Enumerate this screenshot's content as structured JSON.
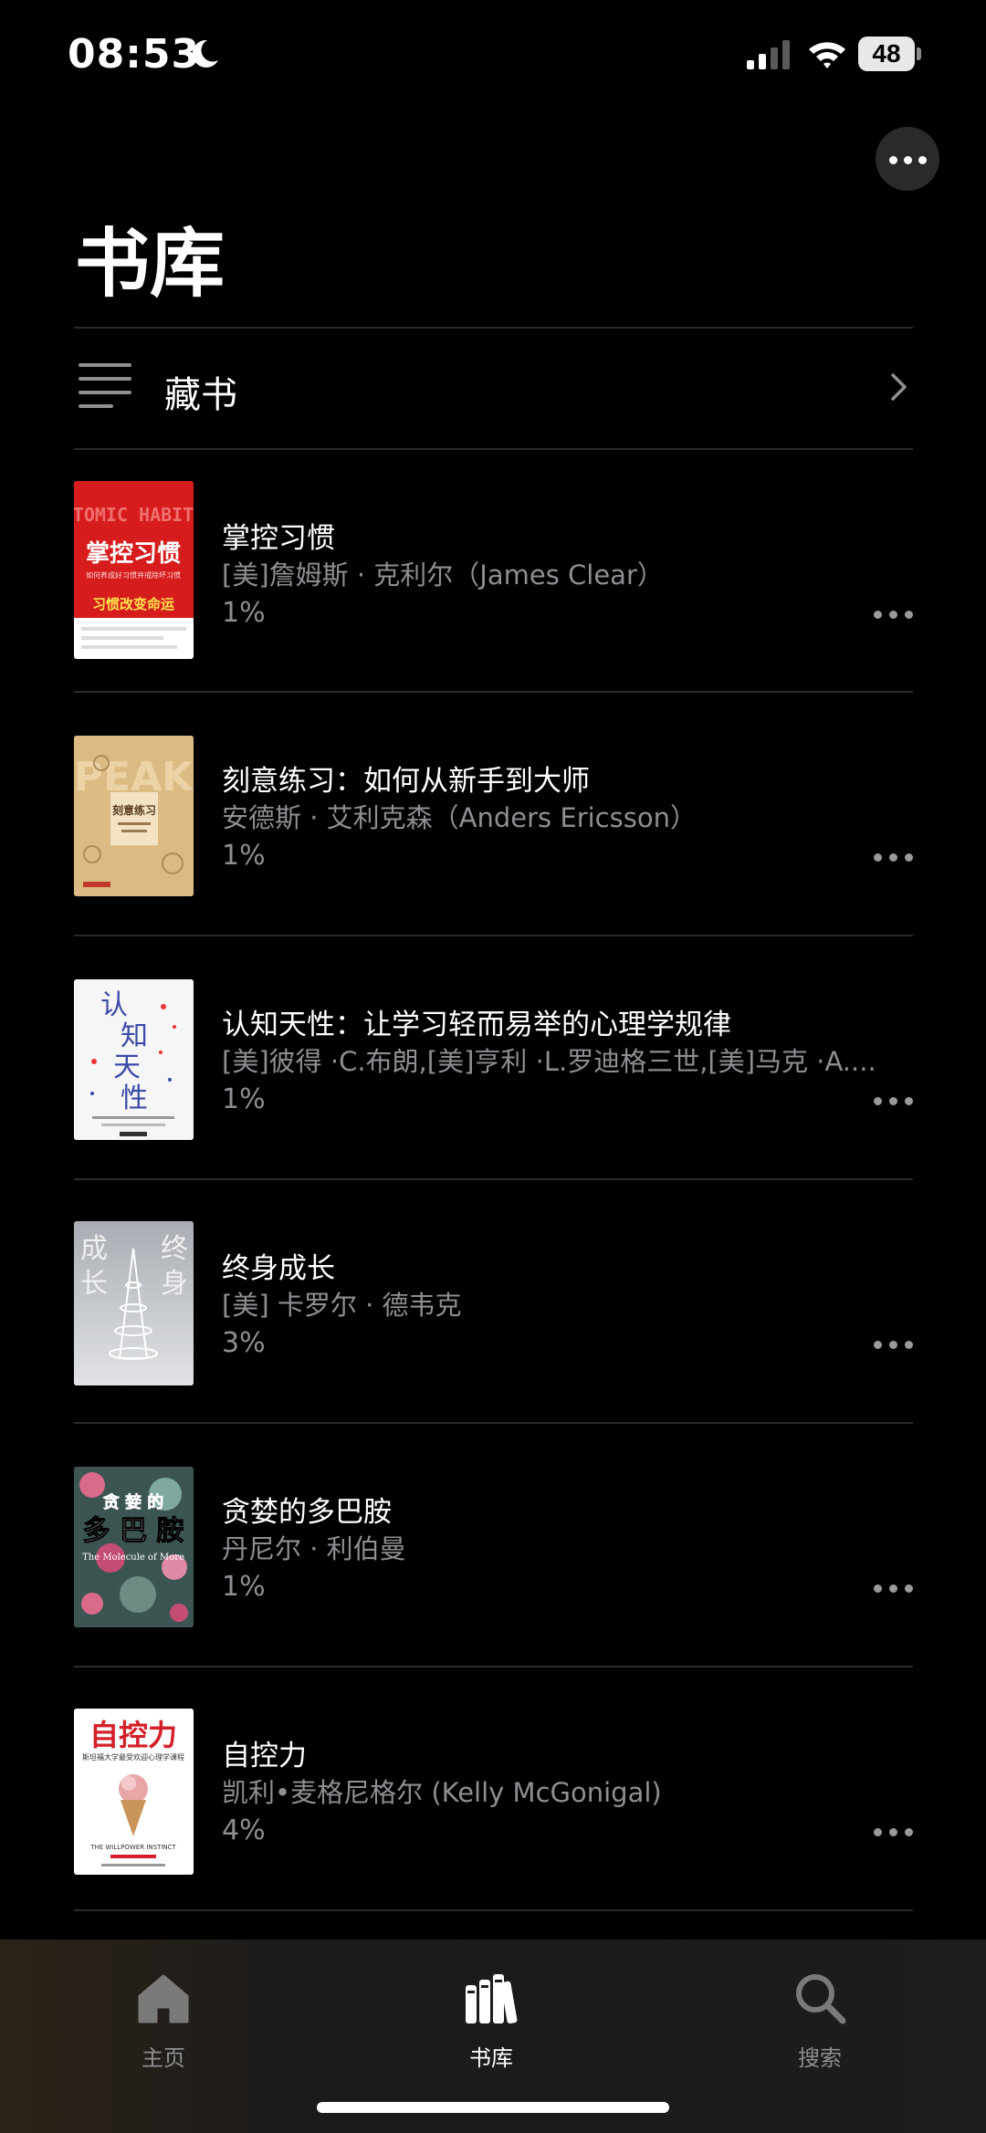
{
  "status_bar": {
    "time": "08:53",
    "battery": "48"
  },
  "header": {
    "title": "书库"
  },
  "collection": {
    "label": "藏书"
  },
  "books": [
    {
      "title": "掌控习惯",
      "author": "[美]詹姆斯 · 克利尔（James Clear）",
      "progress": "1%",
      "cover": {
        "title": "掌控习惯",
        "en": "ATOMIC HABITS",
        "subtitle": "如何养成好习惯并戒除坏习惯",
        "tagline": "习惯改变命运"
      }
    },
    {
      "title": "刻意练习：如何从新手到大师",
      "author": "安德斯 · 艾利克森（Anders Ericsson）",
      "progress": "1%",
      "cover": {
        "title": "刻意练习",
        "en": "PEAK"
      }
    },
    {
      "title": "认知天性：让学习轻而易举的心理学规律",
      "author": "[美]彼得 ·C.布朗,[美]亨利 ·L.罗迪格三世,[美]马克 ·A....",
      "progress": "1%",
      "cover": {
        "title1": "认",
        "title2": "知",
        "title3": "天",
        "title4": "性"
      }
    },
    {
      "title": "终身成长",
      "author": "[美] 卡罗尔 · 德韦克",
      "progress": "3%",
      "cover": {
        "left1": "成",
        "left2": "长",
        "right1": "终",
        "right2": "身"
      }
    },
    {
      "title": "贪婪的多巴胺",
      "author": "丹尼尔 · 利伯曼",
      "progress": "1%",
      "cover": {
        "line1": "贪 婪 的",
        "line2": "多 巴 胺",
        "en": "The Molecule of More"
      }
    },
    {
      "title": "自控力",
      "author": "凯利•麦格尼格尔 (Kelly McGonigal)",
      "progress": "4%",
      "cover": {
        "title": "自控力",
        "subtitle": "斯坦福大学最受欢迎心理学课程",
        "en": "THE WILLPOWER INSTINCT"
      }
    }
  ],
  "tabs": [
    {
      "label": "主页",
      "icon": "home-icon",
      "active": false
    },
    {
      "label": "书库",
      "icon": "library-icon",
      "active": true
    },
    {
      "label": "搜索",
      "icon": "search-icon",
      "active": false
    }
  ],
  "colors": {
    "background": "#000000",
    "secondary_text": "#8e8e93",
    "divider": "#2a2a2a"
  }
}
